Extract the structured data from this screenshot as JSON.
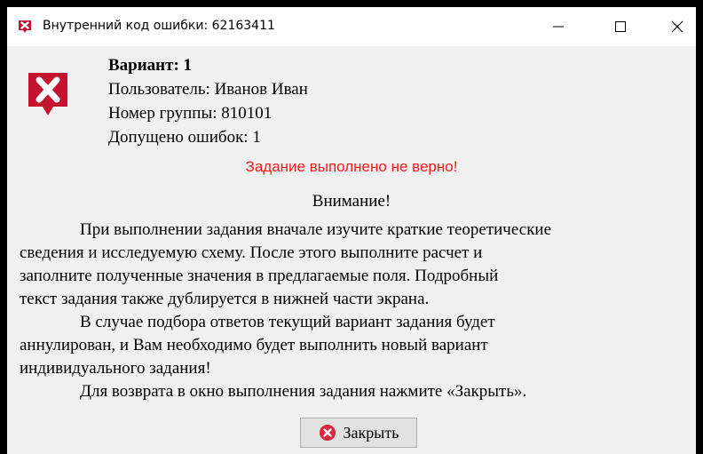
{
  "window": {
    "title": "Внутренний код ошибки: 62163411",
    "icon": "error-app-icon",
    "controls": {
      "minimize": "minimize-icon",
      "maximize": "maximize-icon",
      "close": "close-icon"
    }
  },
  "info": {
    "variant": "Вариант: 1",
    "user": "Пользователь: Иванов Иван",
    "group": "Номер группы: 810101",
    "errors": "Допущено ошибок: 1"
  },
  "error_message": "Задание выполнено не верно!",
  "attention_title": "Внимание!",
  "paragraph1": [
    "При выполнении задания вначале изучите краткие теоретические",
    "сведения и исследуемую схему. После этого выполните расчет и",
    "заполните полученные значения в предлагаемые поля. Подробный",
    "текст задания также дублируется в нижней части экрана."
  ],
  "paragraph2": [
    "В случае подбора ответов текущий вариант задания будет",
    "аннулирован, и Вам необходимо будет выполнить новый вариант",
    "индивидуального задания!"
  ],
  "paragraph3": [
    "Для возврата в окно выполнения задания нажмите «Закрыть»."
  ],
  "close_button": {
    "label": "Закрыть",
    "icon": "error-circle-icon"
  },
  "colors": {
    "error_red": "#ff1a1a",
    "icon_red": "#c4122f",
    "background": "#f0f0f0"
  }
}
